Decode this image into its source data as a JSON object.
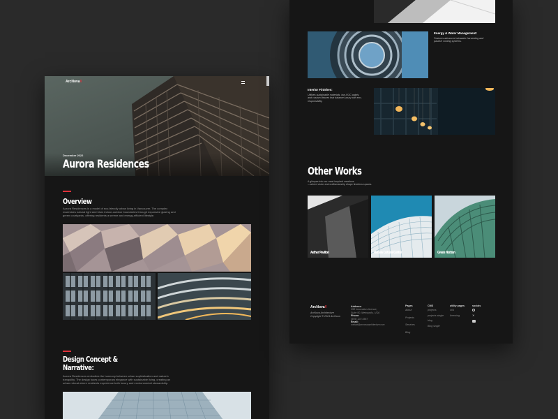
{
  "left": {
    "logo": "ArcNova",
    "hero": {
      "date": "December 2022",
      "title": "Aurora Residences"
    },
    "overview": {
      "heading": "Overview",
      "body": "Aurora Residences is a model of eco-friendly urban living in Vancouver. The complex maximizes natural light and blurs indoor-outdoor boundaries through expansive glazing and green courtyards, offering residents a serene and energy-efficient lifestyle."
    },
    "design": {
      "heading_line1": "Design Concept &",
      "heading_line2": "Narrative:",
      "body": "Aurora Residences embodies the harmony between urban sophistication and nature's tranquility. The design fuses contemporary elegance with sustainable living, creating an urban retreat where residents experience both luxury and environmental stewardship."
    }
  },
  "right": {
    "energy": {
      "heading": "Energy & Water Management:",
      "body": "Features advanced rainwater harvesting and passive cooling systems."
    },
    "interior": {
      "heading": "Interior Finishes:",
      "body": "Utilizes sustainable materials, low-VOC paints, and custom fixtures that balance luxury with eco-responsibility."
    },
    "other_works": {
      "heading": "Other Works",
      "subtitle_line1": "A glimpse into our most inspired creations",
      "subtitle_line2": "—where vision and craftsmanship shape timeless spaces.",
      "items": [
        "Aether Pavilion",
        "Nebula Cultural Center",
        "Green Horizon"
      ]
    },
    "footer": {
      "logo": "ArcNova",
      "tagline": "ArcNova Architecture",
      "copyright": "Copyright © 2024 ArcNova",
      "address_label": "Address:",
      "address_line1": "258 Innovation Avenue,",
      "address_line2": "Suite 50, Metropolis, USA",
      "phone_label": "Phone:",
      "phone": "(555) 123 4567",
      "email_label": "Email:",
      "email": "contact@arcnovaarchitecture.com",
      "pages_label": "Pages",
      "pages": [
        "About",
        "Projects",
        "Services",
        "Blog"
      ],
      "cms_label": "CMS",
      "cms": [
        "projects",
        "projects single",
        "blog",
        "Blog single"
      ],
      "utility_label": "utility pages",
      "utility": [
        "404",
        "licensing"
      ],
      "socials_label": "socials"
    }
  }
}
